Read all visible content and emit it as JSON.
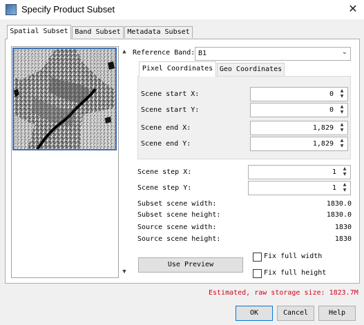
{
  "window": {
    "title": "Specify Product Subset",
    "close_glyph": "✕"
  },
  "tabs": [
    {
      "label": "Spatial Subset",
      "active": true
    },
    {
      "label": "Band Subset",
      "active": false
    },
    {
      "label": "Metadata Subset",
      "active": false
    }
  ],
  "preview": {
    "scroll_up_glyph": "▲",
    "scroll_down_glyph": "▼",
    "thumbnail": "satellite-image-thumbnail"
  },
  "reference_band": {
    "label": "Reference Band:",
    "value": "B1",
    "arrow_glyph": "⌄"
  },
  "coord_tabs": [
    {
      "label": "Pixel Coordinates",
      "active": true
    },
    {
      "label": "Geo Coordinates",
      "active": false
    }
  ],
  "scene": {
    "start_x": {
      "label": "Scene start X:",
      "value": "0"
    },
    "start_y": {
      "label": "Scene start Y:",
      "value": "0"
    },
    "end_x": {
      "label": "Scene end X:",
      "value": "1,829"
    },
    "end_y": {
      "label": "Scene end Y:",
      "value": "1,829"
    },
    "step_x": {
      "label": "Scene step X:",
      "value": "1"
    },
    "step_y": {
      "label": "Scene step Y:",
      "value": "1"
    }
  },
  "spin_glyphs": {
    "up": "▲",
    "down": "▼"
  },
  "info": [
    {
      "label": "Subset scene width:",
      "value": "1830.0"
    },
    {
      "label": "Subset scene height:",
      "value": "1830.0"
    },
    {
      "label": "Source scene width:",
      "value": "1830"
    },
    {
      "label": "Source scene height:",
      "value": "1830"
    }
  ],
  "use_preview_label": "Use Preview",
  "checks": {
    "fix_width": {
      "label": "Fix full width",
      "checked": false
    },
    "fix_height": {
      "label": "Fix full height",
      "checked": false
    }
  },
  "storage_text": "Estimated, raw storage size: 1823.7M",
  "buttons": {
    "ok": "OK",
    "cancel": "Cancel",
    "help": "Help"
  },
  "colors": {
    "accent": "#0078d7",
    "storage_text": "#d2001e",
    "thumb_border": "#3d6fb0"
  }
}
